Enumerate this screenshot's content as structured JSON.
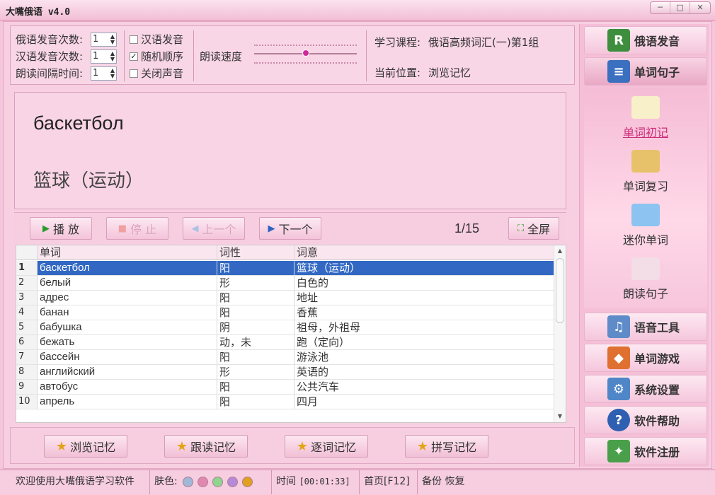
{
  "window": {
    "title": "大嘴俄语 v4.0",
    "buttons": [
      "─",
      "□",
      "✕"
    ]
  },
  "settings": {
    "ru_times_label": "俄语发音次数:",
    "ru_times_value": "1",
    "cn_times_label": "汉语发音次数:",
    "cn_times_value": "1",
    "interval_label": "朗读间隔时间:",
    "interval_value": "1",
    "opt_cn": "汉语发音",
    "opt_cn_checked": false,
    "opt_random": "随机顺序",
    "opt_random_checked": true,
    "opt_mute": "关闭声音",
    "opt_mute_checked": false,
    "speed_label": "朗读速度",
    "speed_level": 0.5,
    "course_label": "学习课程:",
    "course_value": "俄语高频词汇(一)第1组",
    "position_label": "当前位置:",
    "position_value": "浏览记忆"
  },
  "display": {
    "word": "баскетбол",
    "meaning": "篮球（运动）"
  },
  "controls": {
    "play": "播 放",
    "stop": "停 止",
    "prev": "上一个",
    "next": "下一个",
    "counter": "1/15",
    "fullscreen": "全屏"
  },
  "table": {
    "headers": [
      "单词",
      "词性",
      "词意"
    ],
    "rows": [
      {
        "n": "1",
        "word": "баскетбол",
        "pos": "阳",
        "meaning": "篮球（运动）"
      },
      {
        "n": "2",
        "word": "белый",
        "pos": "形",
        "meaning": "白色的"
      },
      {
        "n": "3",
        "word": "адрес",
        "pos": "阳",
        "meaning": "地址"
      },
      {
        "n": "4",
        "word": "банан",
        "pos": "阳",
        "meaning": "香蕉"
      },
      {
        "n": "5",
        "word": "бабушка",
        "pos": "阴",
        "meaning": "祖母，外祖母"
      },
      {
        "n": "6",
        "word": "бежать",
        "pos": "动，未",
        "meaning": "跑（定向）"
      },
      {
        "n": "7",
        "word": "бассейн",
        "pos": "阳",
        "meaning": "游泳池"
      },
      {
        "n": "8",
        "word": "английский",
        "pos": "形",
        "meaning": "英语的"
      },
      {
        "n": "9",
        "word": "автобус",
        "pos": "阳",
        "meaning": "公共汽车"
      },
      {
        "n": "10",
        "word": "апрель",
        "pos": "阳",
        "meaning": "四月"
      }
    ]
  },
  "modes": [
    "浏览记忆",
    "跟读记忆",
    "逐词记忆",
    "拼写记忆"
  ],
  "sidebar": {
    "buttons_top": [
      "俄语发音",
      "单词句子"
    ],
    "sub": [
      "单词初记",
      "单词复习",
      "迷你单词",
      "朗读句子"
    ],
    "buttons_bottom": [
      "语音工具",
      "单词游戏",
      "系统设置",
      "软件帮助",
      "软件注册"
    ]
  },
  "status": {
    "welcome": "欢迎使用大嘴俄语学习软件",
    "skin_label": "肤色:",
    "skin_colors": [
      "#9fb8d6",
      "#e088b0",
      "#8fd58f",
      "#b68ad9",
      "#e0a020"
    ],
    "time_label": "时间",
    "time_value": "[00:01:33]",
    "home": "首页[F12]",
    "backup": "备份",
    "restore": "恢复"
  },
  "colors": {
    "accent": "#cc2d7a",
    "selection": "#3268c3",
    "background": "#f7cfe1"
  }
}
